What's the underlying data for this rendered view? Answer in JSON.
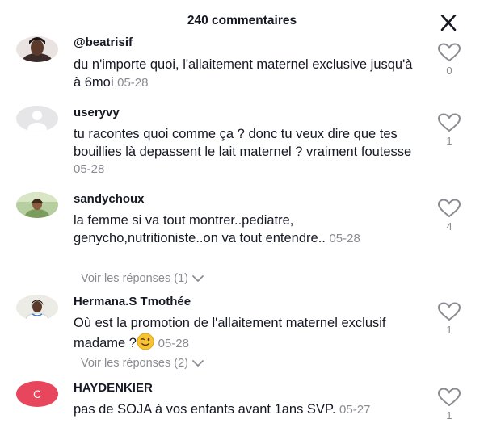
{
  "header": {
    "title": "240 commentaires"
  },
  "comments": [
    {
      "username": "@beatrisif",
      "text": "du n'importe quoi, l'allaitement maternel exclusive jusqu'à à 6moi",
      "date": "05-28",
      "likes": "0",
      "avatar": "photo-avatar"
    },
    {
      "username": "useryvy",
      "text": "tu racontes quoi comme ça ? donc tu veux dire que tes bouillies là depassent le lait maternel ? vraiment foutesse",
      "date": "05-28",
      "likes": "1",
      "avatar": "default-user-avatar"
    },
    {
      "username": "sandychoux",
      "text": "la femme si va tout montrer..pediatre, genycho,nutritioniste..on va tout entendre..",
      "date": "05-28",
      "likes": "4",
      "replies": "Voir les réponses (1)",
      "avatar": "photo-avatar"
    },
    {
      "username": "Hermana.S Tmothée",
      "text": "Où est la promotion de l'allaitement maternel exclusif madame ?",
      "date": "05-28",
      "likes": "1",
      "replies": "Voir les réponses (2)",
      "emoji": "winking-face-emoji",
      "avatar": "photo-avatar"
    },
    {
      "username": "HAYDENKIER",
      "text": "pas de SOJA à vos enfants avant 1ans SVP.",
      "date": "05-27",
      "likes": "1",
      "avatar_letter": "C",
      "avatar_color": "#e8465c"
    }
  ]
}
